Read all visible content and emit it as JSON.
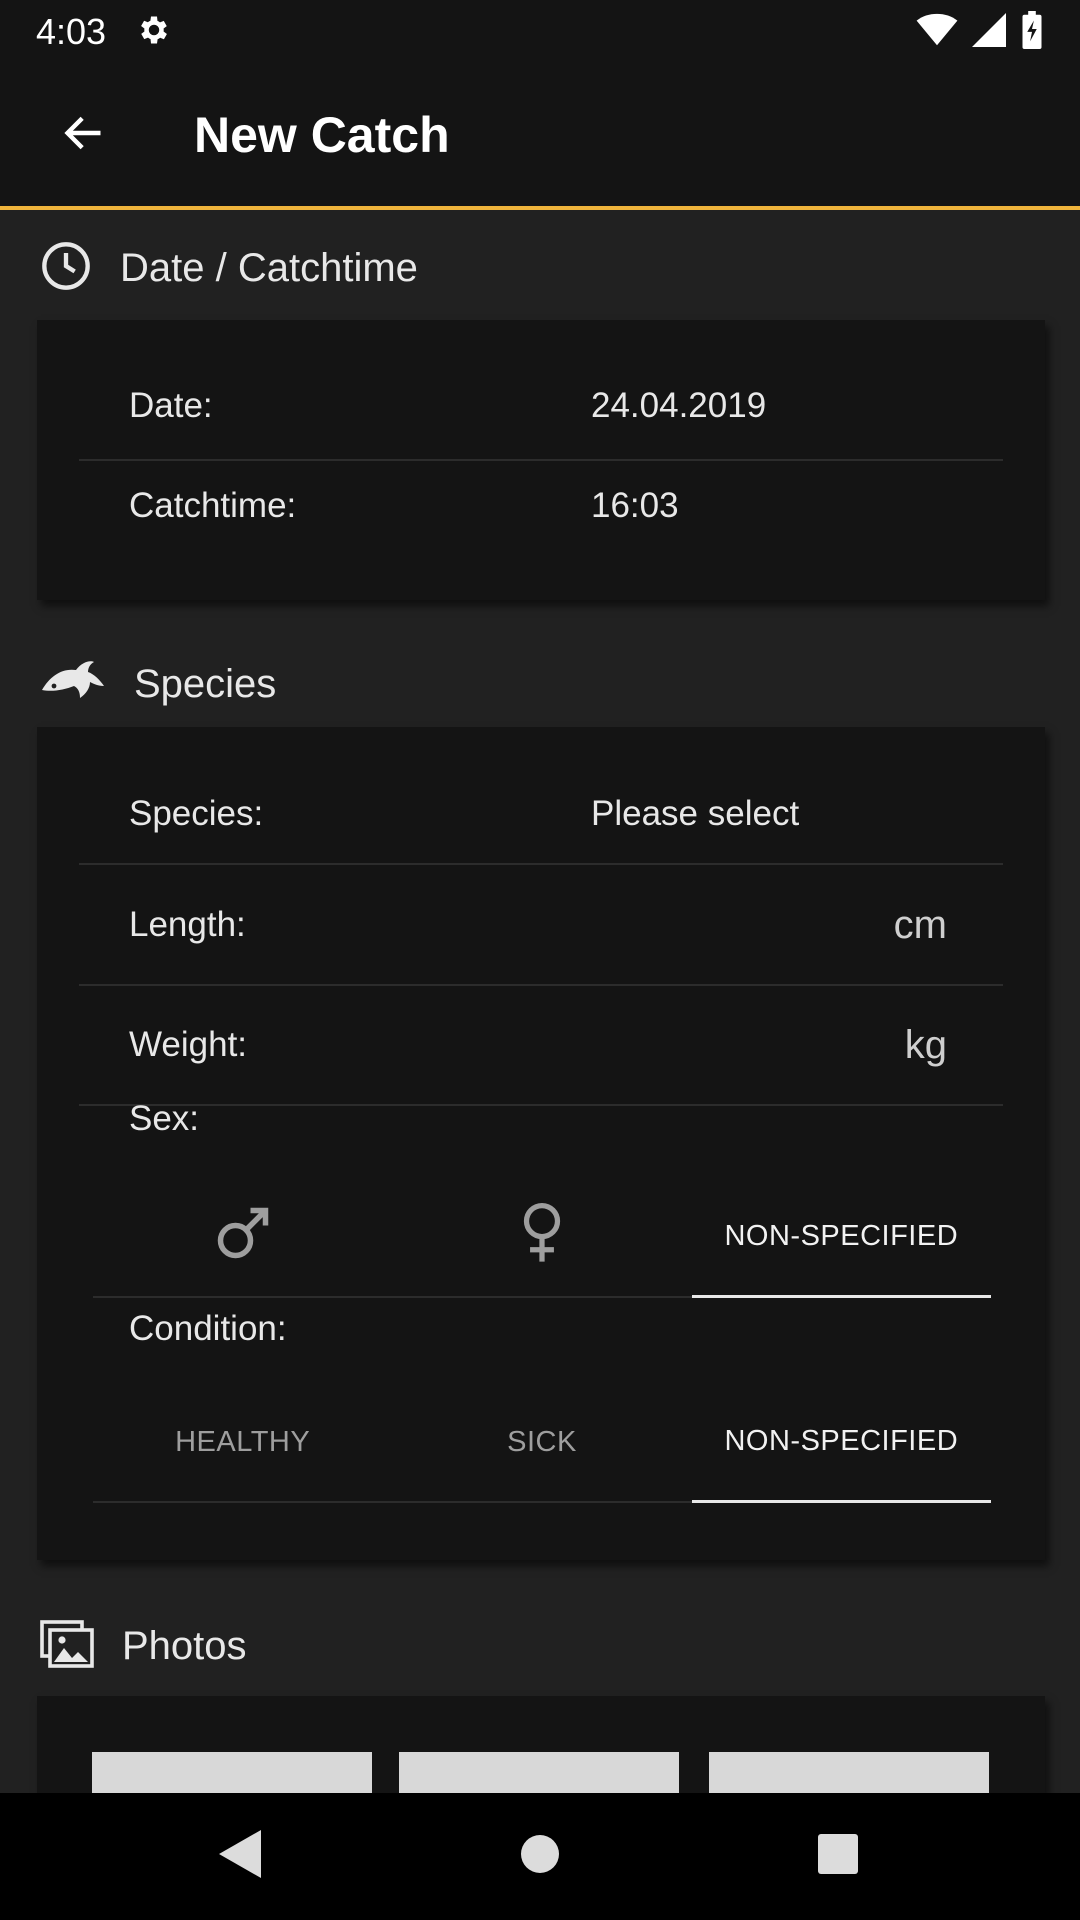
{
  "status_bar": {
    "time": "4:03"
  },
  "app_bar": {
    "title": "New Catch"
  },
  "sections": {
    "date": {
      "title": "Date / Catchtime",
      "date_label": "Date:",
      "date_value": "24.04.2019",
      "time_label": "Catchtime:",
      "time_value": "16:03"
    },
    "species": {
      "title": "Species",
      "species_label": "Species:",
      "species_value": "Please select",
      "length_label": "Length:",
      "length_unit": "cm",
      "weight_label": "Weight:",
      "weight_unit": "kg",
      "sex_label": "Sex:",
      "sex_options": [
        "male",
        "female",
        "NON-SPECIFIED"
      ],
      "sex_selected": "NON-SPECIFIED",
      "condition_label": "Condition:",
      "condition_options": [
        "HEALTHY",
        "SICK",
        "NON-SPECIFIED"
      ],
      "condition_selected": "NON-SPECIFIED"
    },
    "photos": {
      "title": "Photos"
    }
  },
  "icons": {
    "back": "arrow-left-icon",
    "clock": "clock-icon",
    "fish": "fish-icon",
    "photos": "photos-icon",
    "settings": "gear-icon",
    "wifi": "wifi-icon",
    "signal": "signal-icon",
    "battery": "battery-charging-icon"
  },
  "colors": {
    "accent": "#f0b43c",
    "background": "#212121",
    "card": "#141414"
  }
}
